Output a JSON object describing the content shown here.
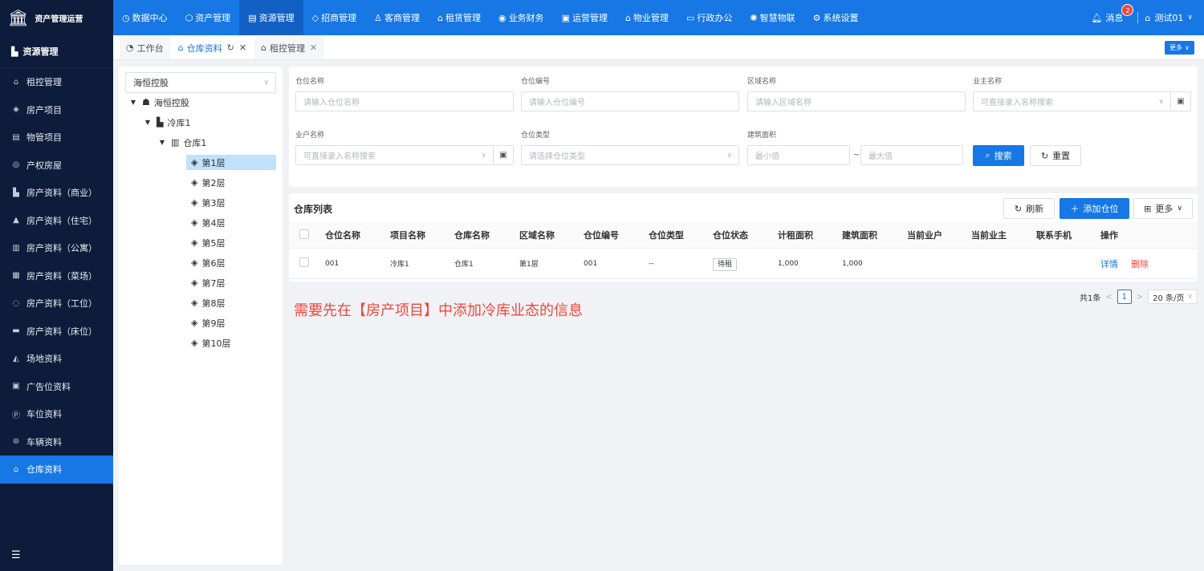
{
  "brand": {
    "logo_icon": "bank-icon",
    "title": "资产管理运营"
  },
  "topnav": [
    {
      "label": "数据中心",
      "icon": "◷"
    },
    {
      "label": "资产管理",
      "icon": "⬡"
    },
    {
      "label": "资源管理",
      "icon": "▤"
    },
    {
      "label": "招商管理",
      "icon": "◇"
    },
    {
      "label": "客商管理",
      "icon": "♙"
    },
    {
      "label": "租赁管理",
      "icon": "⌂"
    },
    {
      "label": "业务财务",
      "icon": "◉"
    },
    {
      "label": "运营管理",
      "icon": "▣"
    },
    {
      "label": "物业管理",
      "icon": "⌂"
    },
    {
      "label": "行政办公",
      "icon": "▭"
    },
    {
      "label": "智慧物联",
      "icon": "✺"
    },
    {
      "label": "系统设置",
      "icon": "⚙"
    }
  ],
  "topright": {
    "messages_label": "消息",
    "messages_count": "2",
    "user_label": "测试01"
  },
  "sidebar": {
    "header": "资源管理",
    "items": [
      {
        "label": "租控管理",
        "icon": "⌂"
      },
      {
        "label": "房产项目",
        "icon": "◈"
      },
      {
        "label": "物管项目",
        "icon": "▤"
      },
      {
        "label": "产权房屋",
        "icon": "◎"
      },
      {
        "label": "房产资料（商业）",
        "icon": "▙"
      },
      {
        "label": "房产资料（住宅）",
        "icon": "▲"
      },
      {
        "label": "房产资料（公寓）",
        "icon": "▥"
      },
      {
        "label": "房产资料（菜场）",
        "icon": "▦"
      },
      {
        "label": "房产资料（工位）",
        "icon": "◌"
      },
      {
        "label": "房产资料（床位）",
        "icon": "▬"
      },
      {
        "label": "场地资料",
        "icon": "◭"
      },
      {
        "label": "广告位资料",
        "icon": "▣"
      },
      {
        "label": "车位资料",
        "icon": "Ⓟ"
      },
      {
        "label": "车辆资料",
        "icon": "⊜"
      },
      {
        "label": "仓库资料",
        "icon": "⌂"
      }
    ],
    "active_index": 14
  },
  "tabs": [
    {
      "label": "工作台",
      "icon": "◔"
    },
    {
      "label": "仓库资料",
      "icon": "⌂"
    },
    {
      "label": "租控管理",
      "icon": "⌂"
    }
  ],
  "tabs_more": "更多",
  "tree": {
    "select_value": "海恒控股",
    "nodes": [
      {
        "label": "海恒控股",
        "icon": "☗"
      },
      {
        "label": "冷库1",
        "icon": "▙"
      },
      {
        "label": "仓库1",
        "icon": "▥"
      },
      {
        "label": "第1层",
        "icon": "◈"
      },
      {
        "label": "第2层",
        "icon": "◈"
      },
      {
        "label": "第3层",
        "icon": "◈"
      },
      {
        "label": "第4层",
        "icon": "◈"
      },
      {
        "label": "第5层",
        "icon": "◈"
      },
      {
        "label": "第6层",
        "icon": "◈"
      },
      {
        "label": "第7层",
        "icon": "◈"
      },
      {
        "label": "第8层",
        "icon": "◈"
      },
      {
        "label": "第9层",
        "icon": "◈"
      },
      {
        "label": "第10层",
        "icon": "◈"
      }
    ]
  },
  "search": {
    "warehouse_name": {
      "label": "仓位名称",
      "placeholder": "请输入仓位名称"
    },
    "warehouse_code": {
      "label": "仓位编号",
      "placeholder": "请输入仓位编号"
    },
    "area_name": {
      "label": "区域名称",
      "placeholder": "请输入区域名称"
    },
    "owner_name": {
      "label": "业主名称",
      "placeholder": "可直接录入名称搜索"
    },
    "tenant_name": {
      "label": "业户名称",
      "placeholder": "可直接录入名称搜索"
    },
    "warehouse_type": {
      "label": "仓位类型",
      "placeholder": "请选择仓位类型"
    },
    "building_area": {
      "label": "建筑面积",
      "min_placeholder": "最小值",
      "max_placeholder": "最大值",
      "separator": "~"
    },
    "search_button": "搜索",
    "reset_button": "重置"
  },
  "list": {
    "title": "仓库列表",
    "refresh": "刷新",
    "add": "添加仓位",
    "more": "更多",
    "columns": [
      "仓位名称",
      "项目名称",
      "仓库名称",
      "区域名称",
      "仓位编号",
      "仓位类型",
      "仓位状态",
      "计租面积",
      "建筑面积",
      "当前业户",
      "当前业主",
      "联系手机",
      "操作"
    ],
    "rows": [
      {
        "name": "001",
        "project": "冷库1",
        "warehouse": "仓库1",
        "area": "第1层",
        "code": "001",
        "type": "--",
        "status": "待租",
        "rent_area": "1,000",
        "build_area": "1,000",
        "tenant": "",
        "owner": "",
        "phone": "",
        "detail": "详情",
        "delete": "删除"
      }
    ]
  },
  "pager": {
    "total": "共1条",
    "current_page": "1",
    "page_size": "20 条/页"
  },
  "note": "需要先在【房产项目】中添加冷库业态的信息"
}
